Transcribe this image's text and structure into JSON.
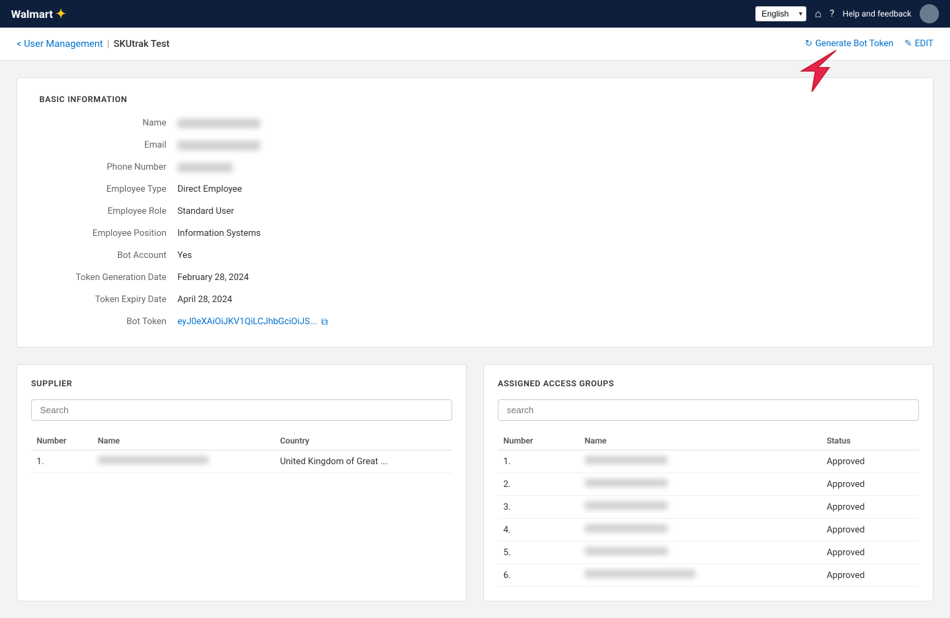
{
  "topNav": {
    "brand": "Walmart",
    "spark": "✦",
    "language": "English",
    "helpText": "Help and feedback"
  },
  "breadcrumb": {
    "back": "< User Management",
    "separator": "|",
    "current": "SKUtrak Test",
    "generateBotToken": "Generate Bot Token",
    "edit": "EDIT"
  },
  "basicInfo": {
    "title": "BASIC INFORMATION",
    "fields": [
      {
        "label": "Name",
        "value": "",
        "blurred": true
      },
      {
        "label": "Email",
        "value": "",
        "blurred": true
      },
      {
        "label": "Phone Number",
        "value": "",
        "blurred": true
      },
      {
        "label": "Employee Type",
        "value": "Direct Employee",
        "blurred": false
      },
      {
        "label": "Employee Role",
        "value": "Standard User",
        "blurred": false
      },
      {
        "label": "Employee Position",
        "value": "Information Systems",
        "blurred": false
      },
      {
        "label": "Bot Account",
        "value": "Yes",
        "blurred": false
      },
      {
        "label": "Token Generation Date",
        "value": "February 28, 2024",
        "blurred": false
      },
      {
        "label": "Token Expiry Date",
        "value": "April 28, 2024",
        "blurred": false
      },
      {
        "label": "Bot Token",
        "value": "eyJ0eXAiOiJKV1QiLCJhbGciOiJS...",
        "blurred": false,
        "isToken": true
      }
    ]
  },
  "supplier": {
    "title": "SUPPLIER",
    "searchPlaceholder": "Search",
    "columns": [
      "Number",
      "Name",
      "Country"
    ],
    "rows": [
      {
        "num": "1.",
        "name": "",
        "country": "United Kingdom of Great ...",
        "blurred": true
      }
    ]
  },
  "assignedAccessGroups": {
    "title": "ASSIGNED ACCESS GROUPS",
    "searchPlaceholder": "search",
    "columns": [
      "Number",
      "Name",
      "Status"
    ],
    "rows": [
      {
        "num": "1.",
        "name": "",
        "status": "Approved",
        "blurred": true
      },
      {
        "num": "2.",
        "name": "",
        "status": "Approved",
        "blurred": true
      },
      {
        "num": "3.",
        "name": "",
        "status": "Approved",
        "blurred": true
      },
      {
        "num": "4.",
        "name": "",
        "status": "Approved",
        "blurred": true
      },
      {
        "num": "5.",
        "name": "",
        "status": "Approved",
        "blurred": true
      },
      {
        "num": "6.",
        "name": "",
        "status": "Approved",
        "blurred": true
      }
    ]
  }
}
